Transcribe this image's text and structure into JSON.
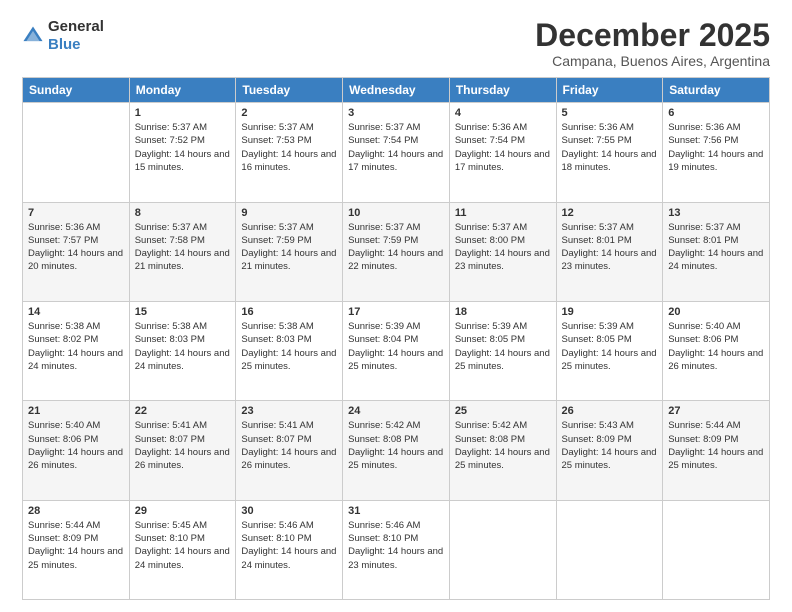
{
  "logo": {
    "general": "General",
    "blue": "Blue"
  },
  "title": "December 2025",
  "subtitle": "Campana, Buenos Aires, Argentina",
  "days_of_week": [
    "Sunday",
    "Monday",
    "Tuesday",
    "Wednesday",
    "Thursday",
    "Friday",
    "Saturday"
  ],
  "weeks": [
    [
      {
        "day": "",
        "info": ""
      },
      {
        "day": "1",
        "info": "Sunrise: 5:37 AM\nSunset: 7:52 PM\nDaylight: 14 hours and 15 minutes."
      },
      {
        "day": "2",
        "info": "Sunrise: 5:37 AM\nSunset: 7:53 PM\nDaylight: 14 hours and 16 minutes."
      },
      {
        "day": "3",
        "info": "Sunrise: 5:37 AM\nSunset: 7:54 PM\nDaylight: 14 hours and 17 minutes."
      },
      {
        "day": "4",
        "info": "Sunrise: 5:36 AM\nSunset: 7:54 PM\nDaylight: 14 hours and 17 minutes."
      },
      {
        "day": "5",
        "info": "Sunrise: 5:36 AM\nSunset: 7:55 PM\nDaylight: 14 hours and 18 minutes."
      },
      {
        "day": "6",
        "info": "Sunrise: 5:36 AM\nSunset: 7:56 PM\nDaylight: 14 hours and 19 minutes."
      }
    ],
    [
      {
        "day": "7",
        "info": "Sunrise: 5:36 AM\nSunset: 7:57 PM\nDaylight: 14 hours and 20 minutes."
      },
      {
        "day": "8",
        "info": "Sunrise: 5:37 AM\nSunset: 7:58 PM\nDaylight: 14 hours and 21 minutes."
      },
      {
        "day": "9",
        "info": "Sunrise: 5:37 AM\nSunset: 7:59 PM\nDaylight: 14 hours and 21 minutes."
      },
      {
        "day": "10",
        "info": "Sunrise: 5:37 AM\nSunset: 7:59 PM\nDaylight: 14 hours and 22 minutes."
      },
      {
        "day": "11",
        "info": "Sunrise: 5:37 AM\nSunset: 8:00 PM\nDaylight: 14 hours and 23 minutes."
      },
      {
        "day": "12",
        "info": "Sunrise: 5:37 AM\nSunset: 8:01 PM\nDaylight: 14 hours and 23 minutes."
      },
      {
        "day": "13",
        "info": "Sunrise: 5:37 AM\nSunset: 8:01 PM\nDaylight: 14 hours and 24 minutes."
      }
    ],
    [
      {
        "day": "14",
        "info": "Sunrise: 5:38 AM\nSunset: 8:02 PM\nDaylight: 14 hours and 24 minutes."
      },
      {
        "day": "15",
        "info": "Sunrise: 5:38 AM\nSunset: 8:03 PM\nDaylight: 14 hours and 24 minutes."
      },
      {
        "day": "16",
        "info": "Sunrise: 5:38 AM\nSunset: 8:03 PM\nDaylight: 14 hours and 25 minutes."
      },
      {
        "day": "17",
        "info": "Sunrise: 5:39 AM\nSunset: 8:04 PM\nDaylight: 14 hours and 25 minutes."
      },
      {
        "day": "18",
        "info": "Sunrise: 5:39 AM\nSunset: 8:05 PM\nDaylight: 14 hours and 25 minutes."
      },
      {
        "day": "19",
        "info": "Sunrise: 5:39 AM\nSunset: 8:05 PM\nDaylight: 14 hours and 25 minutes."
      },
      {
        "day": "20",
        "info": "Sunrise: 5:40 AM\nSunset: 8:06 PM\nDaylight: 14 hours and 26 minutes."
      }
    ],
    [
      {
        "day": "21",
        "info": "Sunrise: 5:40 AM\nSunset: 8:06 PM\nDaylight: 14 hours and 26 minutes."
      },
      {
        "day": "22",
        "info": "Sunrise: 5:41 AM\nSunset: 8:07 PM\nDaylight: 14 hours and 26 minutes."
      },
      {
        "day": "23",
        "info": "Sunrise: 5:41 AM\nSunset: 8:07 PM\nDaylight: 14 hours and 26 minutes."
      },
      {
        "day": "24",
        "info": "Sunrise: 5:42 AM\nSunset: 8:08 PM\nDaylight: 14 hours and 25 minutes."
      },
      {
        "day": "25",
        "info": "Sunrise: 5:42 AM\nSunset: 8:08 PM\nDaylight: 14 hours and 25 minutes."
      },
      {
        "day": "26",
        "info": "Sunrise: 5:43 AM\nSunset: 8:09 PM\nDaylight: 14 hours and 25 minutes."
      },
      {
        "day": "27",
        "info": "Sunrise: 5:44 AM\nSunset: 8:09 PM\nDaylight: 14 hours and 25 minutes."
      }
    ],
    [
      {
        "day": "28",
        "info": "Sunrise: 5:44 AM\nSunset: 8:09 PM\nDaylight: 14 hours and 25 minutes."
      },
      {
        "day": "29",
        "info": "Sunrise: 5:45 AM\nSunset: 8:10 PM\nDaylight: 14 hours and 24 minutes."
      },
      {
        "day": "30",
        "info": "Sunrise: 5:46 AM\nSunset: 8:10 PM\nDaylight: 14 hours and 24 minutes."
      },
      {
        "day": "31",
        "info": "Sunrise: 5:46 AM\nSunset: 8:10 PM\nDaylight: 14 hours and 23 minutes."
      },
      {
        "day": "",
        "info": ""
      },
      {
        "day": "",
        "info": ""
      },
      {
        "day": "",
        "info": ""
      }
    ]
  ]
}
